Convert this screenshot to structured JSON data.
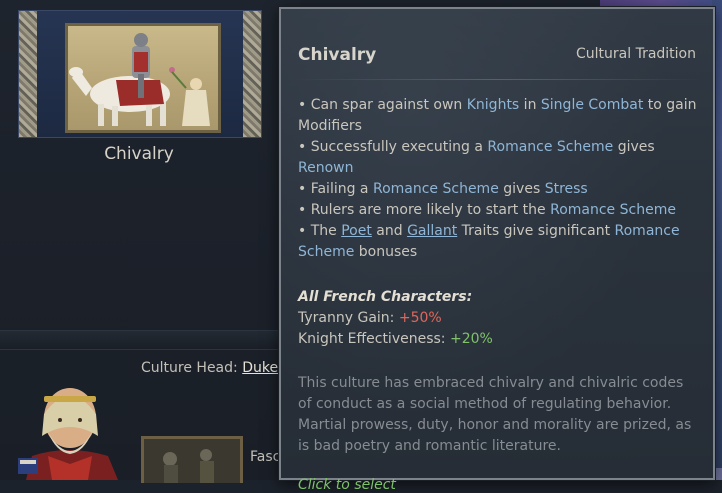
{
  "background": {
    "tradition_card_name": "Chivalry",
    "culture_head_label": "Culture Head:",
    "culture_head_value": "Duke",
    "bottom_partial_text": "Fasc"
  },
  "tooltip": {
    "title": "Chivalry",
    "type": "Cultural Tradition",
    "bullets": [
      {
        "pre": "• Can spar against own ",
        "hl": "Knights",
        "mid": " in ",
        "hl2": "Single Combat",
        "post": " to gain Modifiers"
      },
      {
        "pre": "• Successfully executing a ",
        "hl": "Romance Scheme",
        "mid": " gives ",
        "hl2": "Renown",
        "post": ""
      },
      {
        "pre": "• Failing a ",
        "hl": "Romance Scheme",
        "mid": " gives ",
        "hl2": "Stress",
        "post": ""
      },
      {
        "pre": "• Rulers are more likely to start the ",
        "hl": "Romance Scheme",
        "mid": "",
        "hl2": "",
        "post": ""
      },
      {
        "pre": "• The ",
        "u1": "Poet",
        "and": " and ",
        "u2": "Gallant",
        "mid2": " Traits give significant ",
        "hl": "Romance Scheme",
        "post": " bonuses"
      }
    ],
    "group_heading": "All French Characters:",
    "modifiers": [
      {
        "label": "Tyranny Gain: ",
        "value": "+50%"
      },
      {
        "label": "Knight Effectiveness: ",
        "value": "+20%"
      }
    ],
    "flavor": "This culture has embraced chivalry and chivalric codes of conduct as a social method of regulating behavior. Martial prowess, duty, honor and morality are prized, as is bad poetry and romantic literature.",
    "click_hint": "Click to select"
  },
  "colors": {
    "highlight_blue": "#8fb6d6",
    "negative_red": "#e0675b",
    "positive_green": "#7fc26a",
    "tooltip_border": "#7c838b"
  }
}
